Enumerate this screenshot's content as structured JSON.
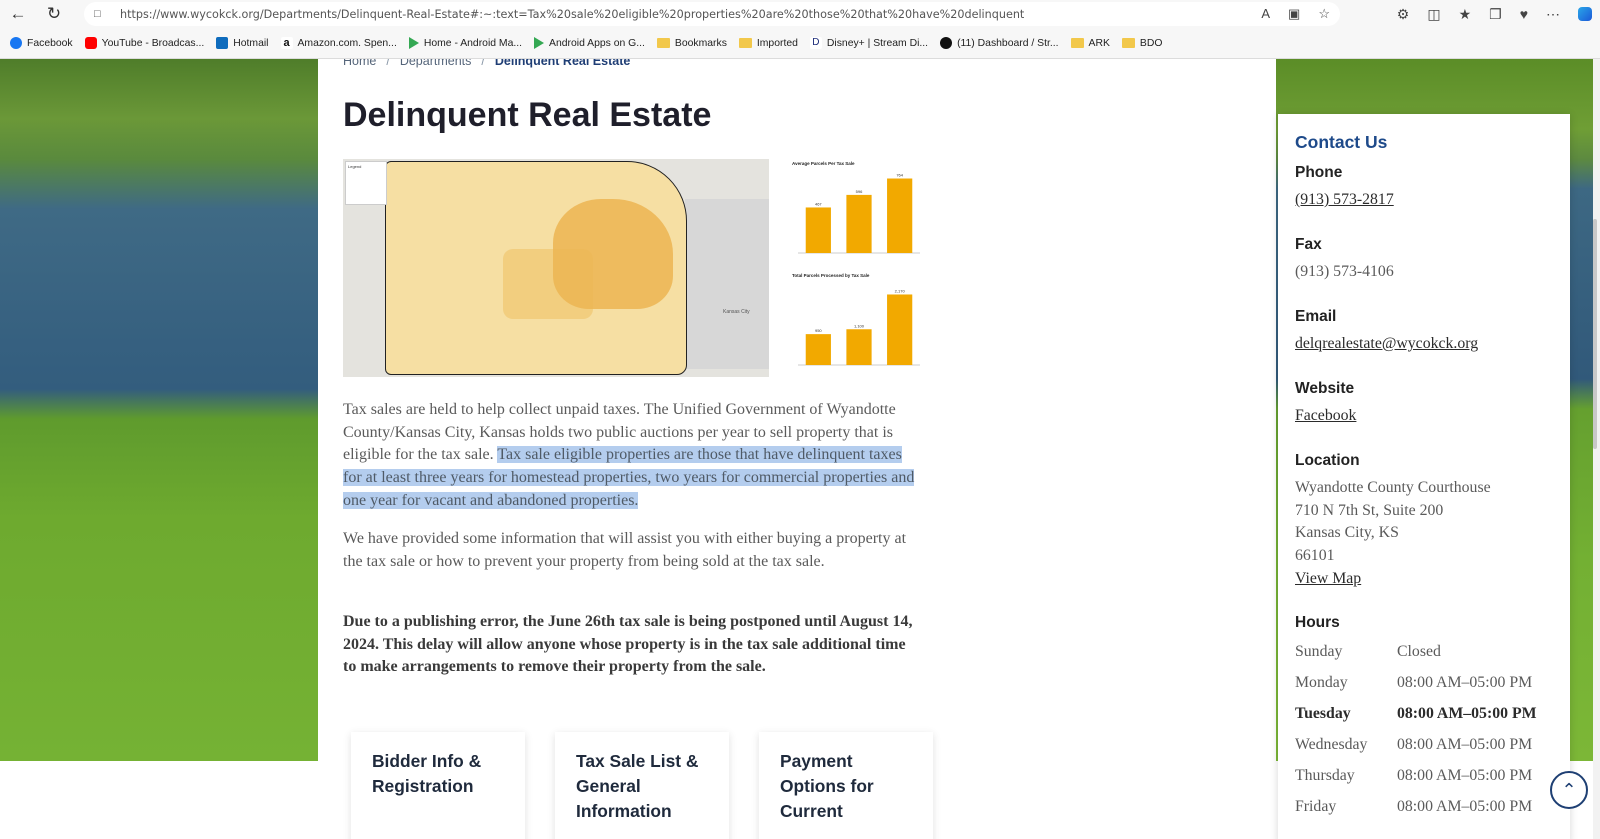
{
  "browser": {
    "url": "https://www.wycokck.org/Departments/Delinquent-Real-Estate#:~:text=Tax%20sale%20eligible%20properties%20are%20those%20that%20have%20delinquent",
    "bookmarks": [
      {
        "label": "Facebook",
        "icon": "facebook-icon"
      },
      {
        "label": "YouTube - Broadcas...",
        "icon": "youtube-icon"
      },
      {
        "label": "Hotmail",
        "icon": "outlook-icon"
      },
      {
        "label": "Amazon.com. Spen...",
        "icon": "amazon-icon"
      },
      {
        "label": "Home - Android Ma...",
        "icon": "google-play-icon"
      },
      {
        "label": "Android Apps on G...",
        "icon": "google-play-icon"
      },
      {
        "label": "Bookmarks",
        "icon": "folder-icon"
      },
      {
        "label": "Imported",
        "icon": "folder-icon"
      },
      {
        "label": "Disney+ | Stream Di...",
        "icon": "disney-icon"
      },
      {
        "label": "(11) Dashboard / Str...",
        "icon": "dashboard-icon"
      },
      {
        "label": "ARK",
        "icon": "folder-icon"
      },
      {
        "label": "BDO",
        "icon": "folder-icon"
      }
    ]
  },
  "breadcrumb": {
    "home": "Home",
    "sep1": "/",
    "departments": "Departments",
    "sep2": "/",
    "current": "Delinquent Real Estate"
  },
  "page": {
    "title": "Delinquent Real Estate",
    "para1_plain": "Tax sales are held to help collect unpaid taxes. The Unified Government of Wyandotte County/Kansas City, Kansas holds two public auctions per year to sell property that is eligible for the tax sale.",
    "para1_highlight": "Tax sale eligible properties are those that have delinquent taxes for at least three years for homestead properties, two years for commercial properties and one year for vacant and abandoned properties.",
    "para2": "We have provided some information that will assist you with either buying a property at the tax sale or how to prevent your property from being sold at the tax sale.",
    "para3": "Due to a publishing error, the June 26th tax sale is being postponed until August 14, 2024. This delay will allow anyone whose property is in the tax sale additional time to make arrangements to remove their property from the sale.",
    "cards": [
      "Bidder Info & Registration",
      "Tax Sale List & General Information",
      "Payment Options for Current"
    ]
  },
  "map": {
    "legend": "Legend",
    "city_label": "Kansas City"
  },
  "chart_data": [
    {
      "type": "bar",
      "title": "Average Parcels Per Tax Sale",
      "categories": [
        "",
        "",
        ""
      ],
      "values": [
        467,
        596,
        764
      ],
      "ylim": [
        0,
        800
      ],
      "color": "#f2a900"
    },
    {
      "type": "bar",
      "title": "Total Parcels Processed by Tax Sale",
      "categories": [
        "",
        "",
        ""
      ],
      "values": [
        950,
        1100,
        2170
      ],
      "ylim": [
        0,
        2400
      ],
      "color": "#f2a900"
    }
  ],
  "contact": {
    "title": "Contact Us",
    "phone_label": "Phone",
    "phone": "(913) 573-2817",
    "fax_label": "Fax",
    "fax": "(913) 573-4106",
    "email_label": "Email",
    "email": "delqrealestate@wycokck.org",
    "website_label": "Website",
    "website": "Facebook",
    "location_label": "Location",
    "location_lines": [
      "Wyandotte County Courthouse",
      "710 N 7th St, Suite 200",
      "Kansas City, KS",
      "66101"
    ],
    "view_map": "View Map",
    "hours_label": "Hours",
    "hours": [
      {
        "day": "Sunday",
        "time": "Closed"
      },
      {
        "day": "Monday",
        "time": "08:00 AM–05:00 PM"
      },
      {
        "day": "Tuesday",
        "time": "08:00 AM–05:00 PM"
      },
      {
        "day": "Wednesday",
        "time": "08:00 AM–05:00 PM"
      },
      {
        "day": "Thursday",
        "time": "08:00 AM–05:00 PM"
      },
      {
        "day": "Friday",
        "time": "08:00 AM–05:00 PM"
      }
    ]
  },
  "colors": {
    "accent": "#1e4a8a",
    "highlight": "#b4cdee",
    "bar": "#f2a900"
  }
}
